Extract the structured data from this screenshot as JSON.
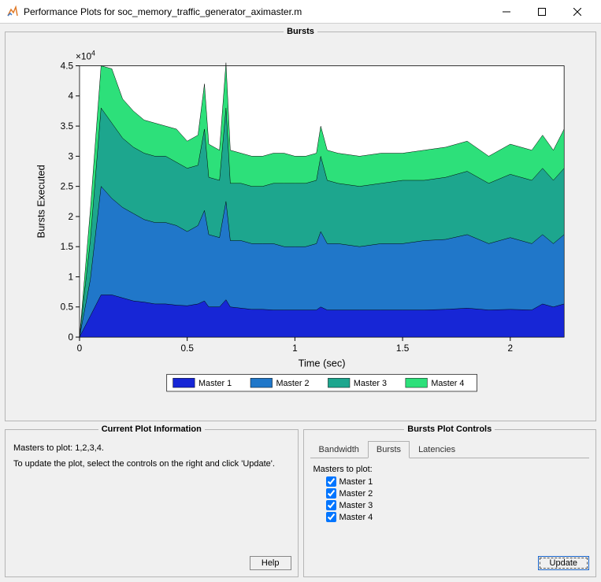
{
  "window": {
    "title": "Performance Plots for soc_memory_traffic_generator_aximaster.m"
  },
  "plot_panel_title": "Bursts",
  "chart_data": {
    "type": "area",
    "title": "",
    "xlabel": "Time (sec)",
    "ylabel": "Bursts Executed",
    "y_scale_exp": "×10",
    "y_scale_exp_sup": "4",
    "xlim": [
      0,
      2.25
    ],
    "xticks": [
      0,
      0.5,
      1,
      1.5,
      2
    ],
    "ylim": [
      0,
      4.5
    ],
    "yticks": [
      0,
      0.5,
      1,
      1.5,
      2,
      2.5,
      3,
      3.5,
      4,
      4.5
    ],
    "x": [
      0,
      0.05,
      0.1,
      0.15,
      0.2,
      0.25,
      0.3,
      0.35,
      0.4,
      0.45,
      0.5,
      0.55,
      0.58,
      0.6,
      0.65,
      0.68,
      0.7,
      0.75,
      0.8,
      0.85,
      0.9,
      0.95,
      1,
      1.05,
      1.1,
      1.12,
      1.15,
      1.2,
      1.3,
      1.4,
      1.5,
      1.6,
      1.7,
      1.8,
      1.9,
      2,
      2.1,
      2.15,
      2.2,
      2.25
    ],
    "series": [
      {
        "name": "Master 1",
        "color": "#1726d6",
        "values": [
          0,
          0.35,
          0.7,
          0.7,
          0.65,
          0.6,
          0.58,
          0.55,
          0.55,
          0.53,
          0.52,
          0.55,
          0.6,
          0.5,
          0.5,
          0.62,
          0.5,
          0.48,
          0.46,
          0.46,
          0.45,
          0.45,
          0.45,
          0.45,
          0.45,
          0.5,
          0.45,
          0.45,
          0.45,
          0.45,
          0.45,
          0.45,
          0.46,
          0.48,
          0.45,
          0.46,
          0.45,
          0.55,
          0.5,
          0.55
        ]
      },
      {
        "name": "Master 2",
        "color": "#2077c9",
        "values": [
          0,
          0.95,
          2.5,
          2.3,
          2.15,
          2.05,
          1.95,
          1.9,
          1.9,
          1.85,
          1.75,
          1.85,
          2.1,
          1.7,
          1.65,
          2.25,
          1.6,
          1.6,
          1.55,
          1.55,
          1.55,
          1.5,
          1.5,
          1.5,
          1.55,
          1.75,
          1.55,
          1.55,
          1.5,
          1.55,
          1.55,
          1.6,
          1.62,
          1.7,
          1.55,
          1.65,
          1.55,
          1.7,
          1.55,
          1.7
        ]
      },
      {
        "name": "Master 3",
        "color": "#1da68e",
        "values": [
          0,
          1.6,
          3.8,
          3.55,
          3.3,
          3.15,
          3.05,
          3.0,
          3.0,
          2.9,
          2.8,
          2.85,
          3.45,
          2.65,
          2.6,
          3.8,
          2.55,
          2.55,
          2.5,
          2.5,
          2.55,
          2.55,
          2.55,
          2.55,
          2.6,
          3.0,
          2.6,
          2.55,
          2.5,
          2.55,
          2.6,
          2.6,
          2.65,
          2.75,
          2.55,
          2.7,
          2.6,
          2.8,
          2.6,
          2.8
        ]
      },
      {
        "name": "Master 4",
        "color": "#2de07a",
        "values": [
          0,
          2.1,
          4.5,
          4.45,
          3.95,
          3.75,
          3.6,
          3.55,
          3.5,
          3.45,
          3.25,
          3.35,
          4.2,
          3.2,
          3.1,
          4.55,
          3.1,
          3.05,
          3.0,
          3.0,
          3.05,
          3.05,
          3.0,
          3.0,
          3.05,
          3.5,
          3.1,
          3.05,
          3.0,
          3.05,
          3.05,
          3.1,
          3.15,
          3.25,
          3.0,
          3.2,
          3.1,
          3.35,
          3.1,
          3.45
        ]
      }
    ],
    "legend": [
      "Master 1",
      "Master 2",
      "Master 3",
      "Master 4"
    ]
  },
  "info_panel": {
    "title": "Current Plot Information",
    "line1": "Masters to plot: 1,2,3,4.",
    "line2": "To update the plot, select the controls on the right and click 'Update'.",
    "help_btn": "Help"
  },
  "controls_panel": {
    "title": "Bursts Plot Controls",
    "tabs": {
      "bandwidth": "Bandwidth",
      "bursts": "Bursts",
      "latencies": "Latencies"
    },
    "group_label": "Masters to plot:",
    "items": [
      {
        "label": "Master 1",
        "checked": true
      },
      {
        "label": "Master 2",
        "checked": true
      },
      {
        "label": "Master 3",
        "checked": true
      },
      {
        "label": "Master 4",
        "checked": true
      }
    ],
    "update_btn": "Update"
  }
}
